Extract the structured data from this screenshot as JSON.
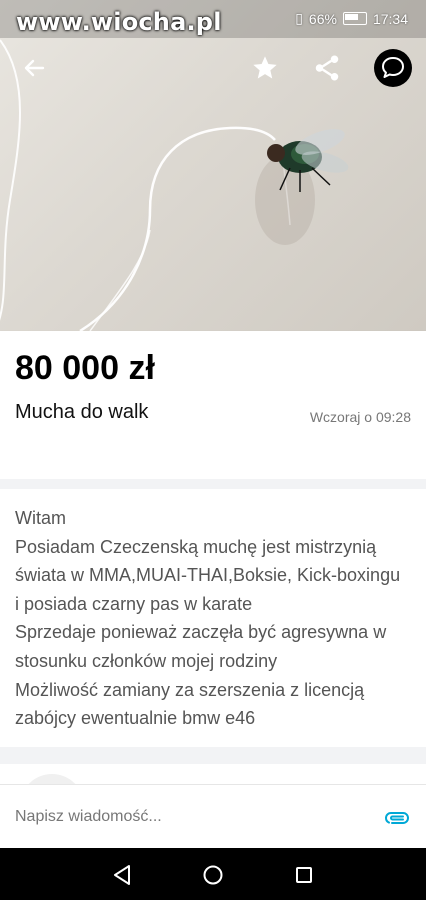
{
  "status_bar": {
    "watermark": "www.wiocha.pl",
    "battery_percent": "66%",
    "time": "17:34"
  },
  "listing": {
    "price": "80 000 zł",
    "title": "Mucha do walk",
    "date": "Wczoraj o 09:28",
    "description_lines": [
      "Witam",
      "Posiadam Czeczenską muchę jest mistrzynią",
      "świata w MMA,MUAI-THAI,Boksie, Kick-boxingu",
      "i posiada czarny pas w karate",
      "Sprzedaje ponieważ zaczęła być agresywna w",
      "stosunku członków mojej rodziny",
      "Możliwość zamiany za szerszenia z licencją",
      "zabójcy ewentualnie bmw e46"
    ]
  },
  "message": {
    "placeholder": "Napisz wiadomość..."
  },
  "colors": {
    "accent": "#00a8d6",
    "text_primary": "#000000",
    "text_secondary": "#555555",
    "date_text": "#777777"
  },
  "icons": {
    "back": "arrow-left-icon",
    "favorite": "star-icon",
    "share": "share-icon",
    "chat": "chat-bubble-icon",
    "attach": "paperclip-icon",
    "nav_back": "triangle-back-icon",
    "nav_home": "circle-home-icon",
    "nav_recents": "square-recents-icon"
  }
}
